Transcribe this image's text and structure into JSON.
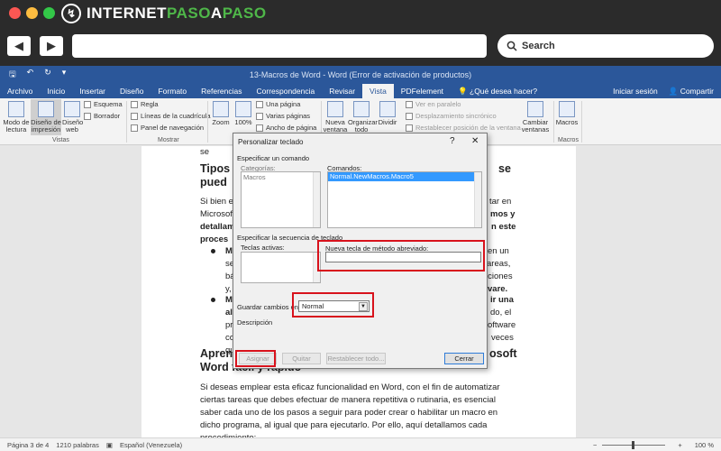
{
  "site": {
    "brand_a": "INTERNET",
    "brand_b": "PASO",
    "brand_c": "A",
    "brand_d": "PASO",
    "search_placeholder": "Search"
  },
  "window": {
    "title": "13-Macros de Word  -  Word (Error de activación de productos)"
  },
  "tabs": [
    "Archivo",
    "Inicio",
    "Insertar",
    "Diseño",
    "Formato",
    "Referencias",
    "Correspondencia",
    "Revisar",
    "Vista",
    "PDFelement"
  ],
  "active_tab": "Vista",
  "tell_me": "¿Qué desea hacer?",
  "sign_in": "Iniciar sesión",
  "share": "Compartir",
  "ribbon": {
    "modo_lectura": "Modo de lectura",
    "diseno_impresion": "Diseño de impresión",
    "diseno_web": "Diseño web",
    "esquema": "Esquema",
    "borrador": "Borrador",
    "regla": "Regla",
    "lineas": "Líneas de la cuadrícula",
    "panel": "Panel de navegación",
    "zoom": "Zoom",
    "zoom100": "100%",
    "una_pagina": "Una página",
    "varias_paginas": "Varias páginas",
    "ancho_pagina": "Ancho de página",
    "nueva_ventana": "Nueva ventana",
    "organizar": "Organizar todo",
    "dividir": "Dividir",
    "ver_paralelo": "Ver en paralelo",
    "desplazamiento": "Desplazamiento sincrónico",
    "restablecer": "Restablecer posición de la ventana",
    "cambiar": "Cambiar ventanas",
    "macros": "Macros",
    "grp_vistas": "Vistas",
    "grp_mostrar": "Mostrar",
    "grp_macros": "Macros"
  },
  "document": {
    "line0": "se",
    "heading1a": "Tipos",
    "heading1b": "se",
    "heading1c": "pued",
    "p1": [
      "Si bien e",
      "Microsof",
      "detallam",
      "proces"
    ],
    "p1r": [
      "tar en",
      "mos y",
      "n este"
    ],
    "b1": [
      "M",
      "se",
      "bá",
      "y,"
    ],
    "b1r": [
      "en un",
      "areas,",
      "iciones",
      "vare."
    ],
    "b2": [
      "M",
      "al",
      "pr",
      "co",
      "qu"
    ],
    "b2r": [
      "ir una",
      "do, el",
      "oftware",
      "veces"
    ],
    "heading2a": "Apren",
    "heading2b": "osoft",
    "heading2c": "Word fácil y rápido",
    "p2": [
      "Si deseas emplear esta eficaz funcionalidad en Word, con el fin de automatizar",
      "ciertas tareas que debes efectuar de manera repetitiva o rutinaria, es esencial",
      "saber cada uno de los pasos a seguir para poder crear o habilitar un macro en",
      "dicho programa, al igual que para ejecutarlo. Por ello, aquí detallamos cada",
      "procedimiento:"
    ]
  },
  "dialog": {
    "title": "Personalizar teclado",
    "help": "?",
    "close": "✕",
    "specify_command": "Especificar un comando",
    "categories_label": "Categorías:",
    "categories": [
      "Macros"
    ],
    "commands_label": "Comandos:",
    "commands": [
      "Normal.NewMacros.Macro5"
    ],
    "specify_sequence": "Especificar la secuencia de teclado",
    "current_keys_label": "Teclas activas:",
    "new_key_label": "Nueva tecla de método abreviado:",
    "new_key_value": "",
    "save_in_label": "Guardar cambios en:",
    "save_in_value": "Normal",
    "description_label": "Descripción",
    "assign": "Asignar",
    "remove": "Quitar",
    "reset_all": "Restablecer todo...",
    "close_btn": "Cerrar"
  },
  "status": {
    "page": "Página 3 de 4",
    "words": "1210 palabras",
    "language": "Español (Venezuela)",
    "zoom": "100 %"
  },
  "colors": {
    "word_blue": "#2b579a",
    "highlight_red": "#d8121c",
    "selection_blue": "#3399ff",
    "brand_green": "#4fb749"
  }
}
